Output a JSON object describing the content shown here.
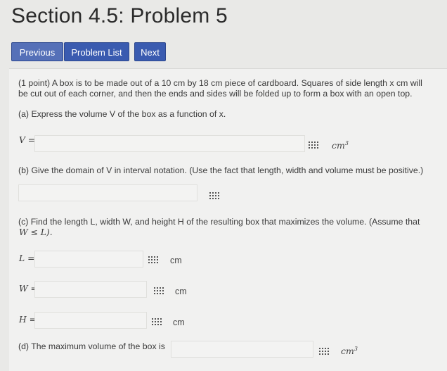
{
  "header": {
    "title": "Section 4.5: Problem 5"
  },
  "nav": {
    "previous": "Previous",
    "problem_list": "Problem List",
    "next": "Next"
  },
  "problem": {
    "intro_line1": "(1 point) A box is to be made out of a 10 cm by 18 cm piece of cardboard. Squares of side length x cm will",
    "intro_line2": "be cut out of each corner, and then the ends and sides will be folded up to form a box with an open top.",
    "part_a": "(a) Express the volume V of the box as a function of x.",
    "part_a_label": "V =",
    "part_a_unit": "cm",
    "part_a_exp": "3",
    "part_b": "(b) Give the domain of V in interval notation. (Use the fact that length, width and volume must be positive.)",
    "part_c_line1": "(c) Find the length L, width W, and height H of the resulting box that maximizes the volume. (Assume that",
    "part_c_line2": "W ≤ L).",
    "L_label": "L =",
    "W_label": "W =",
    "H_label": "H =",
    "cm": "cm",
    "part_d": "(d) The maximum volume of the box is",
    "part_d_unit": "cm",
    "part_d_exp": "3"
  },
  "icons": {
    "answer_tool": "keyboard-grid-icon"
  }
}
